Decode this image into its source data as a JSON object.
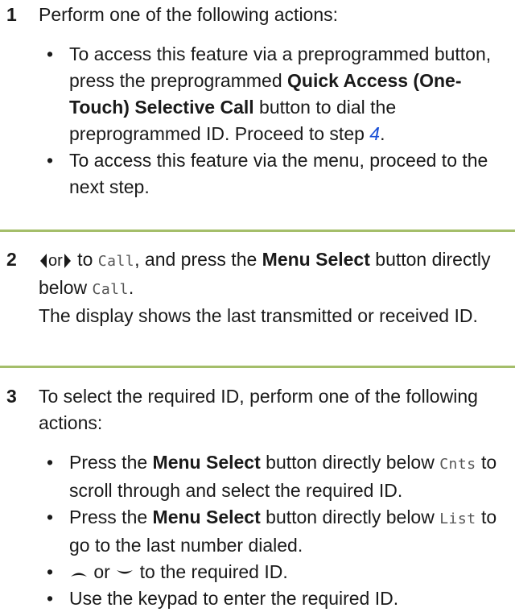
{
  "step1": {
    "number": "1",
    "intro": "Perform one of the following actions:",
    "bullet1": {
      "t1": "To access this feature via a preprogrammed button, press the preprogrammed ",
      "bold": "Quick Access (One-Touch) Selective Call",
      "t2": " button to dial the preprogrammed ID. Proceed to step ",
      "link": "4",
      "t3": "."
    },
    "bullet2": "To access this feature via the menu, proceed to the next step."
  },
  "step2": {
    "number": "2",
    "or": "or",
    "to": " to ",
    "call_code": "Call",
    "press": ", and press the ",
    "menu_select": "Menu Select",
    "button_below": " button directly below ",
    "call_code2": "Call",
    "period": ".",
    "display_text": "The display shows the last transmitted or received ID."
  },
  "step3": {
    "number": "3",
    "intro": "To select the required ID, perform one of the following actions:",
    "bullet1": {
      "t1": "Press the ",
      "bold": "Menu Select",
      "t2": " button directly below ",
      "code": "Cnts",
      "t3": " to scroll through and select the required ID."
    },
    "bullet2": {
      "t1": "Press the ",
      "bold": "Menu Select",
      "t2": " button directly below ",
      "code": "List",
      "t3": " to go to the last number dialed."
    },
    "bullet3": {
      "or": " or ",
      "t": " to the required ID."
    },
    "bullet4": "Use the keypad to enter the required ID."
  },
  "bullet_char": "•",
  "icons": {
    "left": "left-arrow-icon",
    "right": "right-arrow-icon",
    "up": "up-arrow-icon",
    "down": "down-arrow-icon"
  },
  "colors": {
    "separator": "#a4be6a",
    "link": "#1a4fd6"
  }
}
